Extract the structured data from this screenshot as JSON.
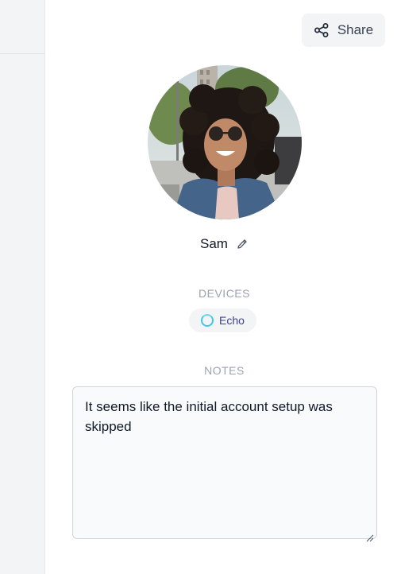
{
  "toolbar": {
    "share_label": "Share"
  },
  "profile": {
    "name": "Sam",
    "avatar_alt": "profile-photo"
  },
  "devices": {
    "heading": "DEVICES",
    "items": [
      {
        "label": "Echo",
        "icon": "alexa-ring-icon",
        "color": "#3fc8e6"
      }
    ]
  },
  "notes": {
    "heading": "NOTES",
    "value": "It seems like the initial account setup was skipped"
  },
  "colors": {
    "sidebar_bg": "#f3f4f6",
    "muted_label": "#9ca3af",
    "chip_text": "#3b3f8f"
  }
}
